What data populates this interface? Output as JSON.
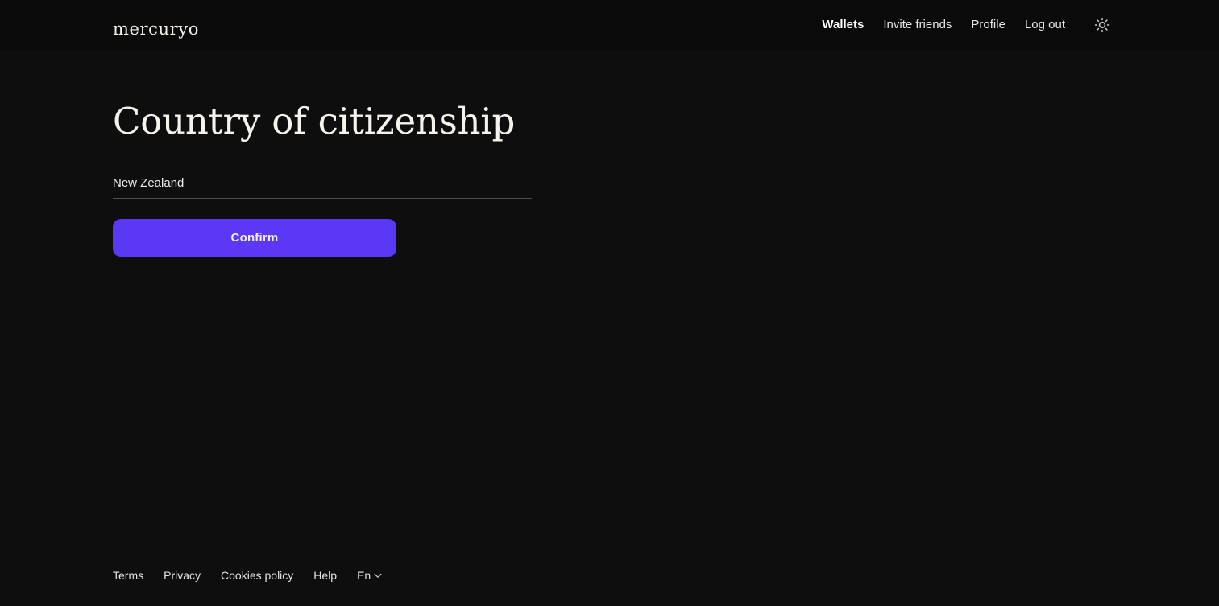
{
  "header": {
    "logo_text": "mercuryo",
    "logo_icon": "mercuryo-wordmark",
    "nav_items": [
      {
        "label": "Wallets",
        "active": true
      },
      {
        "label": "Invite friends",
        "active": false
      },
      {
        "label": "Profile",
        "active": false
      },
      {
        "label": "Log out",
        "active": false
      }
    ],
    "theme_toggle_icon": "sun-icon",
    "background_color": "#0a0a0a"
  },
  "main": {
    "page_title": "Country of citizenship",
    "country_field": {
      "value": "New Zealand",
      "placeholder": "Country of citizenship"
    },
    "confirm_label": "Confirm",
    "accent_color": "#5a38f5"
  },
  "footer": {
    "links": [
      {
        "label": "Terms"
      },
      {
        "label": "Privacy"
      },
      {
        "label": "Cookies policy"
      },
      {
        "label": "Help"
      }
    ],
    "language": {
      "label": "En",
      "chevron_icon": "chevron-down-icon"
    }
  },
  "theme": {
    "page_background": "#0e0e0e",
    "text_color": "#ededed",
    "input_underline": "#4f4f4f"
  }
}
